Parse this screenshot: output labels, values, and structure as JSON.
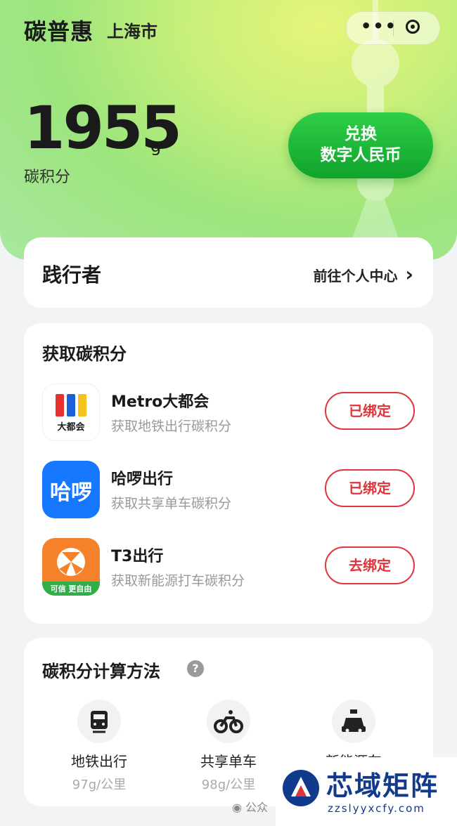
{
  "header": {
    "app_title": "碳普惠",
    "city": "上海市",
    "more": "•••"
  },
  "balance": {
    "points": "1955",
    "unit": "g",
    "label": "碳积分",
    "exchange_line1": "兑换",
    "exchange_line2": "数字人民币"
  },
  "profile": {
    "name": "践行者",
    "link_label": "前往个人中心",
    "chevron": "›"
  },
  "earn": {
    "title": "获取碳积分",
    "apps": [
      {
        "name": "Metro大都会",
        "desc": "获取地铁出行碳积分",
        "button": "已绑定",
        "icon_text": "大都会"
      },
      {
        "name": "哈啰出行",
        "desc": "获取共享单车碳积分",
        "button": "已绑定",
        "icon_text": "哈啰"
      },
      {
        "name": "T3出行",
        "desc": "获取新能源打车碳积分",
        "button": "去绑定",
        "icon_text": "可信 更自由"
      }
    ]
  },
  "calc": {
    "title": "碳积分计算方法",
    "help": "?",
    "methods": [
      {
        "label": "地铁出行",
        "value": "97g/公里",
        "icon": "metro-icon"
      },
      {
        "label": "共享单车",
        "value": "98g/公里",
        "icon": "bike-icon"
      },
      {
        "label": "新能源车",
        "value": "",
        "icon": "taxi-icon"
      }
    ]
  },
  "watermark": {
    "text": "公众",
    "brand": "芯域矩阵",
    "url": "zzslyyxcfy.com"
  },
  "colors": {
    "accent_green": "#10a32d",
    "bind_red": "#e0343c",
    "metro_bg": "#ffffff",
    "hello_bg": "#1677ff",
    "t3_bg": "#f5822a"
  }
}
